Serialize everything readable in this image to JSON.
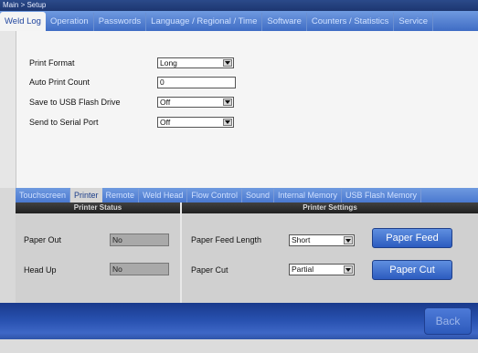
{
  "breadcrumb": "Main > Setup",
  "top_tabs": [
    {
      "label": "Weld Log",
      "active": true
    },
    {
      "label": "Operation",
      "active": false
    },
    {
      "label": "Passwords",
      "active": false
    },
    {
      "label": "Language / Regional / Time",
      "active": false
    },
    {
      "label": "Software",
      "active": false
    },
    {
      "label": "Counters / Statistics",
      "active": false
    },
    {
      "label": "Service",
      "active": false
    }
  ],
  "weld_log": {
    "print_format": {
      "label": "Print Format",
      "value": "Long"
    },
    "auto_print_count": {
      "label": "Auto Print Count",
      "value": "0"
    },
    "save_usb": {
      "label": "Save to USB Flash Drive",
      "value": "Off"
    },
    "send_serial": {
      "label": "Send to Serial Port",
      "value": "Off"
    }
  },
  "sub_tabs": [
    {
      "label": "Touchscreen",
      "active": false
    },
    {
      "label": "Printer",
      "active": true
    },
    {
      "label": "Remote",
      "active": false
    },
    {
      "label": "Weld Head",
      "active": false
    },
    {
      "label": "Flow Control",
      "active": false
    },
    {
      "label": "Sound",
      "active": false
    },
    {
      "label": "Internal Memory",
      "active": false
    },
    {
      "label": "USB Flash Memory",
      "active": false
    }
  ],
  "printer_status": {
    "title": "Printer Status",
    "paper_out": {
      "label": "Paper Out",
      "value": "No"
    },
    "head_up": {
      "label": "Head Up",
      "value": "No"
    }
  },
  "printer_settings": {
    "title": "Printer Settings",
    "paper_feed_length": {
      "label": "Paper Feed Length",
      "value": "Short"
    },
    "paper_cut": {
      "label": "Paper Cut",
      "value": "Partial"
    },
    "paper_feed_button": "Paper Feed",
    "paper_cut_button": "Paper Cut"
  },
  "back_button": "Back",
  "icons": [
    "dropdown-arrow-icon"
  ]
}
